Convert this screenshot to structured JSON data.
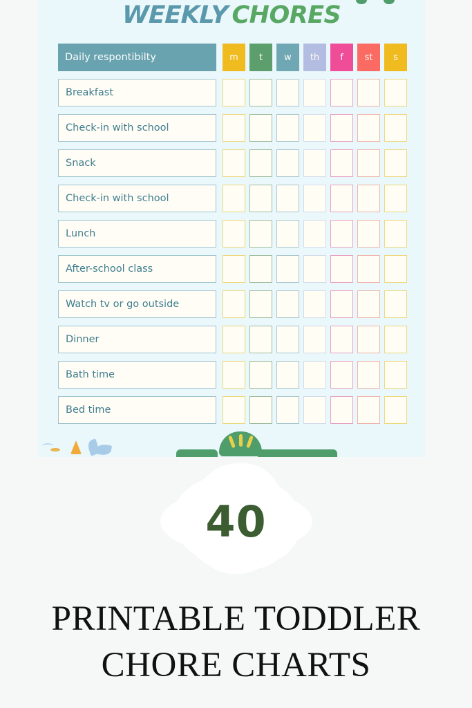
{
  "page": {
    "background_color": "#f5f8f7"
  },
  "chore_card": {
    "background_color": "#eaf7fb",
    "title": {
      "word1": "WEEKLY",
      "word2": "CHORES",
      "word1_color": "#5a98ab",
      "word2_color": "#58a863"
    },
    "table": {
      "header": {
        "responsibility_label": "Daily respontibilty",
        "responsibility_bg": "#69a3b0",
        "days": [
          {
            "label": "m",
            "color": "#efbb1f"
          },
          {
            "label": "t",
            "color": "#5d9f6c"
          },
          {
            "label": "w",
            "color": "#6fa8b4"
          },
          {
            "label": "th",
            "color": "#b3bde2"
          },
          {
            "label": "f",
            "color": "#ef4d97"
          },
          {
            "label": "st",
            "color": "#fb6a63"
          },
          {
            "label": "s",
            "color": "#efbb1f"
          }
        ]
      },
      "check_border_colors": [
        "#ecd77a",
        "#9dbb9f",
        "#a8c6cd",
        "#d3daea",
        "#e8a0c0",
        "#f0b3ab",
        "#ecd77a"
      ],
      "row_border_color": "#9fc4cd",
      "row_text_color": "#3f7e8e",
      "rows": [
        "Breakfast",
        "Check-in with school",
        " Snack",
        "Check-in with school",
        "Lunch",
        "After-school class",
        "Watch tv or go outside",
        "Dinner",
        "Bath time",
        "Bed time"
      ]
    },
    "decorations": {
      "grass_color": "#4f9d6b",
      "crown_ray_color": "#e8d04a",
      "kite_color": "#f0a93a",
      "leaf_color": "#a8cce8"
    }
  },
  "count_badge": {
    "number": "40",
    "number_color": "#3c5c31",
    "splatter_color": "#ffffff"
  },
  "bottom_heading": {
    "line1": "PRINTABLE TODDLER",
    "line2": "CHORE CHARTS",
    "color": "#111111"
  }
}
